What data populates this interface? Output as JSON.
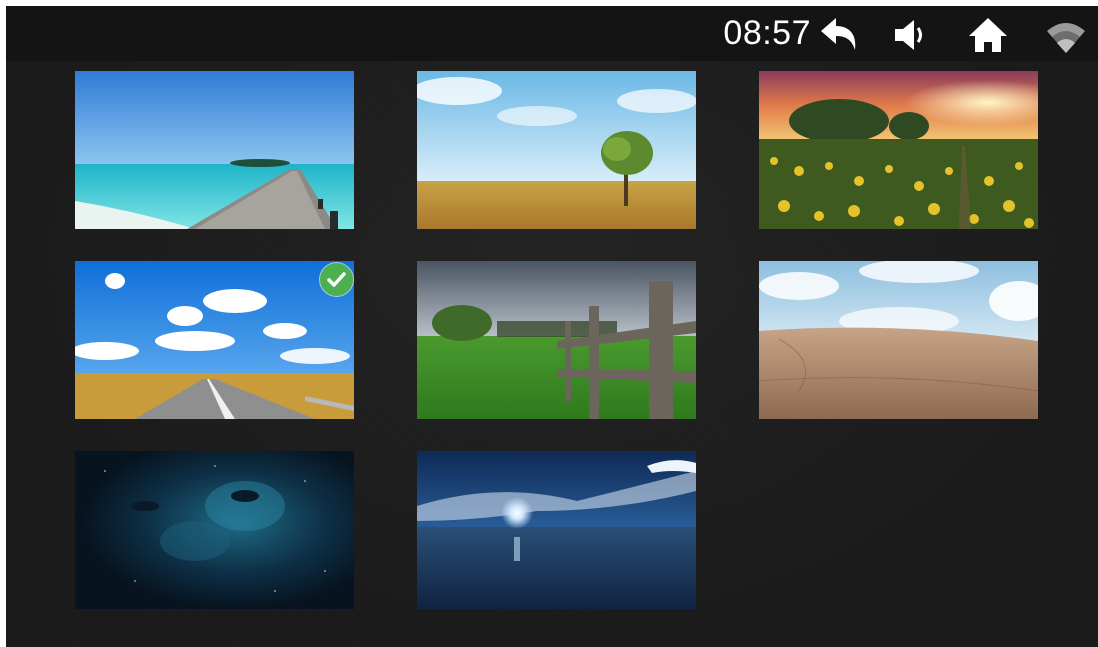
{
  "status_bar": {
    "time": "08:57",
    "icons": [
      "back-arrow-icon",
      "volume-icon",
      "home-icon",
      "wifi-icon"
    ]
  },
  "wallpapers": [
    {
      "name": "beach-pier",
      "selected": false
    },
    {
      "name": "meadow-tree",
      "selected": false
    },
    {
      "name": "flower-field-sunset",
      "selected": false
    },
    {
      "name": "road-blue-sky",
      "selected": true
    },
    {
      "name": "grass-fence",
      "selected": false
    },
    {
      "name": "desert-dunes",
      "selected": false
    },
    {
      "name": "nebula-space",
      "selected": false
    },
    {
      "name": "night-sea-moon",
      "selected": false
    }
  ],
  "colors": {
    "background": "#1a1a1a",
    "status_bar": "#141414",
    "selected_check": "#4caf50",
    "icon": "#ffffff"
  }
}
